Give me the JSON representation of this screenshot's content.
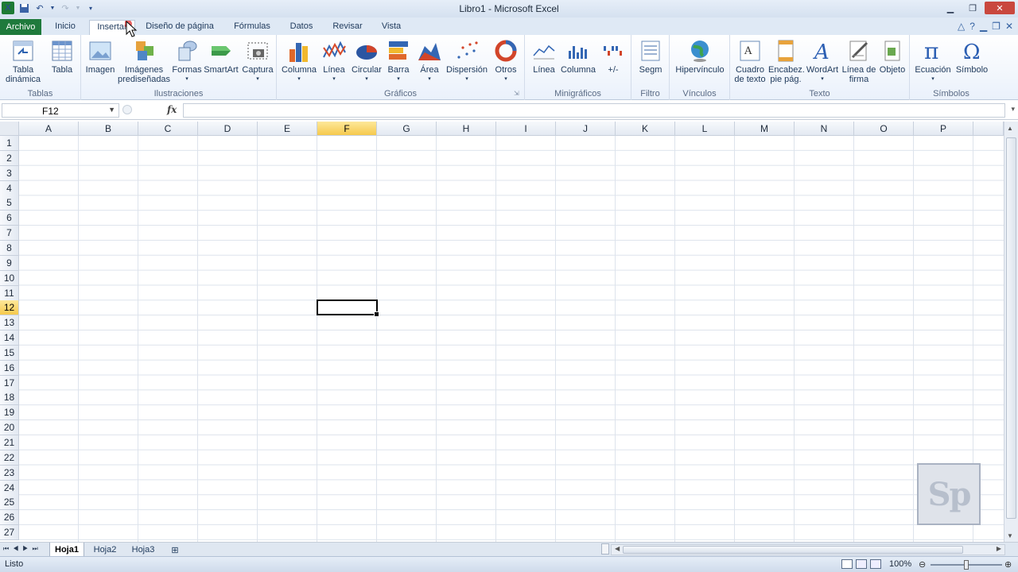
{
  "title": "Libro1  -  Microsoft Excel",
  "tabs": {
    "file": "Archivo",
    "items": [
      "Inicio",
      "Insertar",
      "Diseño de página",
      "Fórmulas",
      "Datos",
      "Revisar",
      "Vista"
    ]
  },
  "ribbon": {
    "groups": {
      "tablas": "Tablas",
      "ilustraciones": "Ilustraciones",
      "graficos": "Gráficos",
      "minigraficos": "Minigráficos",
      "filtro": "Filtro",
      "vinculos": "Vínculos",
      "texto": "Texto",
      "simbolos": "Símbolos"
    },
    "buttons": {
      "tabla_dinamica": "Tabla\ndinámica",
      "tabla": "Tabla",
      "imagen": "Imagen",
      "imagenes": "Imágenes\nprediseñadas",
      "formas": "Formas",
      "smartart": "SmartArt",
      "captura": "Captura",
      "columna": "Columna",
      "linea": "Línea",
      "circular": "Circular",
      "barra": "Barra",
      "area": "Área",
      "dispersion": "Dispersión",
      "otros": "Otros",
      "mini_linea": "Línea",
      "mini_columna": "Columna",
      "mini_pm": "+/-",
      "segm": "Segm",
      "hipervinculo": "Hipervínculo",
      "cuadro_texto": "Cuadro\nde texto",
      "encabez": "Encabez.\npie pág.",
      "wordart": "WordArt",
      "linea_firma": "Línea de\nfirma",
      "objeto": "Objeto",
      "ecuacion": "Ecuación",
      "simbolo": "Símbolo"
    }
  },
  "formula_bar": {
    "name_box": "F12",
    "fx": "fx",
    "value": ""
  },
  "columns": [
    "A",
    "B",
    "C",
    "D",
    "E",
    "F",
    "G",
    "H",
    "I",
    "J",
    "K",
    "L",
    "M",
    "N",
    "O",
    "P"
  ],
  "rows": [
    "1",
    "2",
    "3",
    "4",
    "5",
    "6",
    "7",
    "8",
    "9",
    "10",
    "11",
    "12",
    "13",
    "14",
    "15",
    "16",
    "17",
    "18",
    "19",
    "20",
    "21",
    "22",
    "23",
    "24",
    "25",
    "26",
    "27"
  ],
  "selected_cell": {
    "column": "F",
    "row": "12"
  },
  "sheets": [
    "Hoja1",
    "Hoja2",
    "Hoja3"
  ],
  "active_sheet": "Hoja1",
  "status": "Listo",
  "zoom": "100%",
  "watermark": "Sp"
}
